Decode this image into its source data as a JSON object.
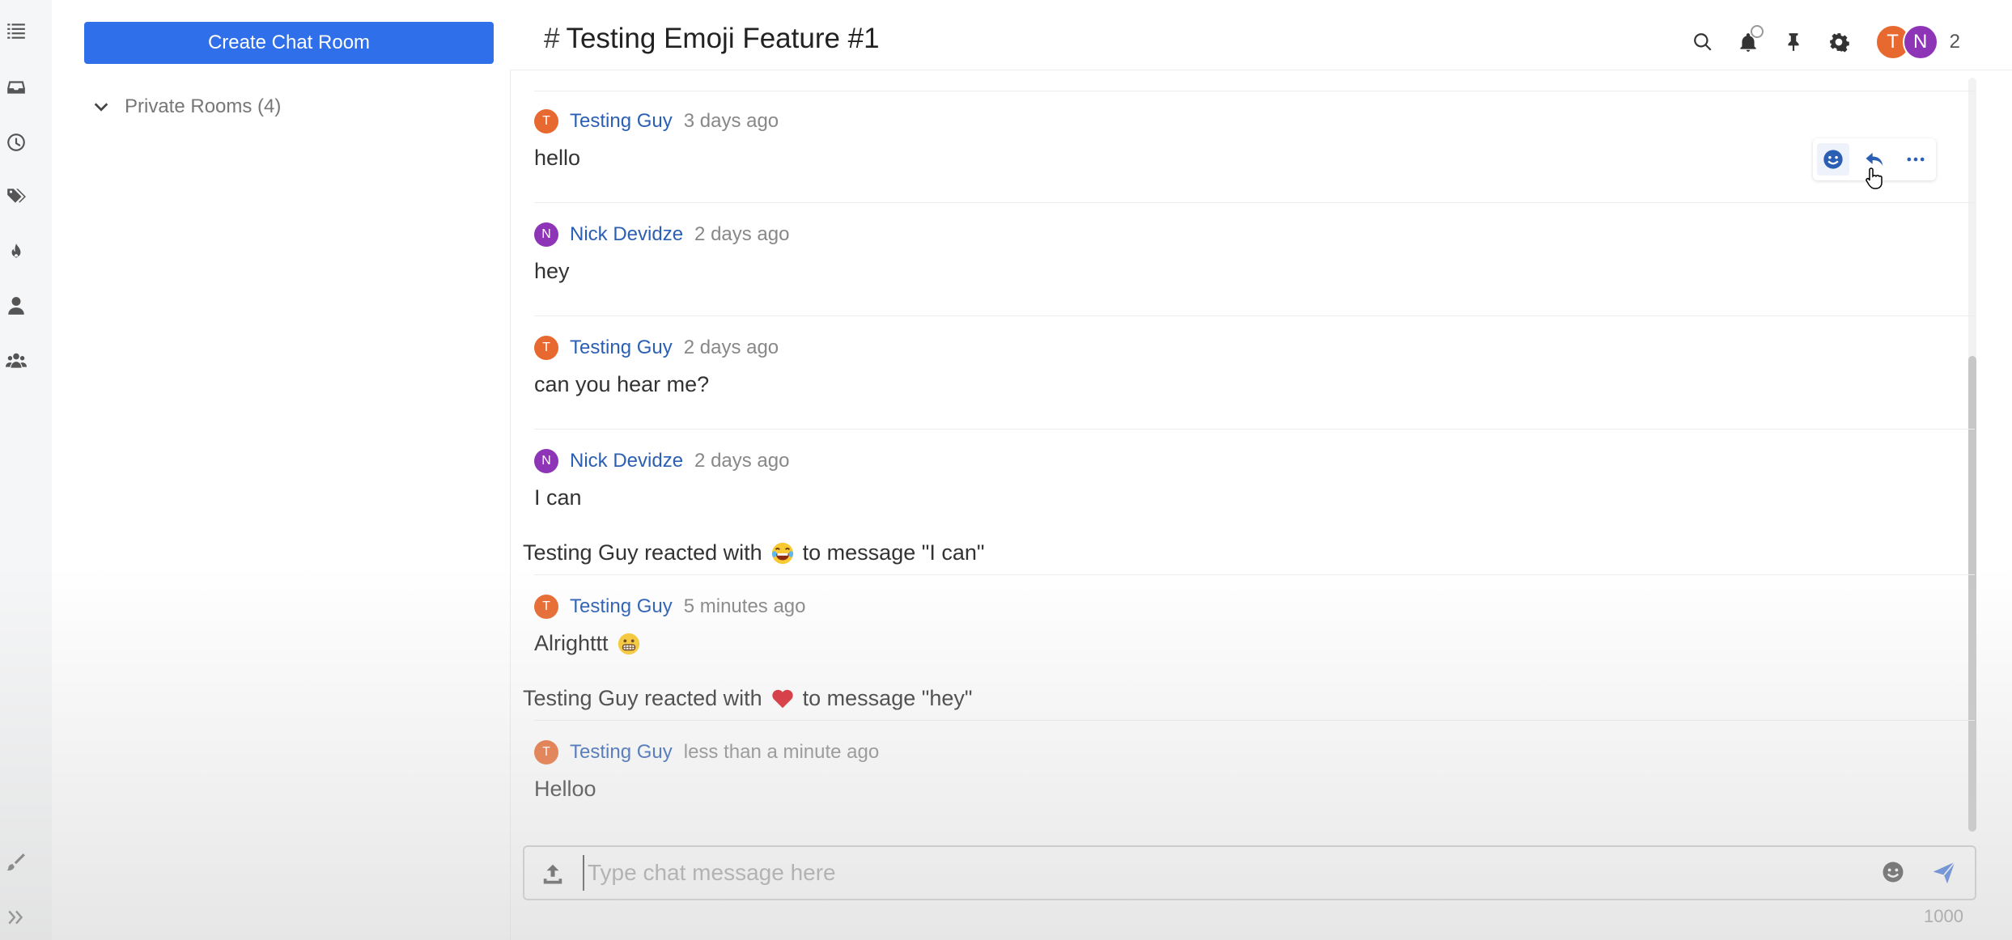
{
  "sidebar": {
    "create_button": "Create Chat Room",
    "section_label": "Private Rooms (4)"
  },
  "rail": {
    "icons": [
      "list-icon",
      "inbox-icon",
      "clock-icon",
      "tags-icon",
      "fire-icon",
      "user-icon",
      "team-icon",
      "brush-icon",
      "expand-icon"
    ]
  },
  "header": {
    "hash": "#",
    "title": "Testing Emoji Feature #1",
    "participants": [
      {
        "initial": "T",
        "color": "#e8692f"
      },
      {
        "initial": "N",
        "color": "#8e35b7"
      }
    ],
    "participant_count": "2"
  },
  "messages": [
    {
      "initial": "T",
      "color": "#e8692f",
      "author": "Testing Guy",
      "time": "3 days ago",
      "text": "hello"
    },
    {
      "initial": "N",
      "color": "#8e35b7",
      "author": "Nick Devidze",
      "time": "2 days ago",
      "text": "hey"
    },
    {
      "initial": "T",
      "color": "#e8692f",
      "author": "Testing Guy",
      "time": "2 days ago",
      "text": "can you hear me?"
    },
    {
      "initial": "N",
      "color": "#8e35b7",
      "author": "Nick Devidze",
      "time": "2 days ago",
      "text": "I can"
    },
    {
      "initial": "T",
      "color": "#e8692f",
      "author": "Testing Guy",
      "time": "5 minutes ago",
      "text": "Alrighttt"
    },
    {
      "initial": "T",
      "color": "#e8692f",
      "author": "Testing Guy",
      "time": "less than a minute ago",
      "text": "Helloo"
    }
  ],
  "reactions": [
    {
      "before": "Testing Guy reacted with",
      "emoji": "laughing-emoji",
      "after": "to message \"I can\""
    },
    {
      "before": "Testing Guy reacted with",
      "emoji": "heart-emoji",
      "after": "to message \"hey\""
    }
  ],
  "composer": {
    "placeholder": "Type chat message here",
    "char_limit": "1000"
  }
}
